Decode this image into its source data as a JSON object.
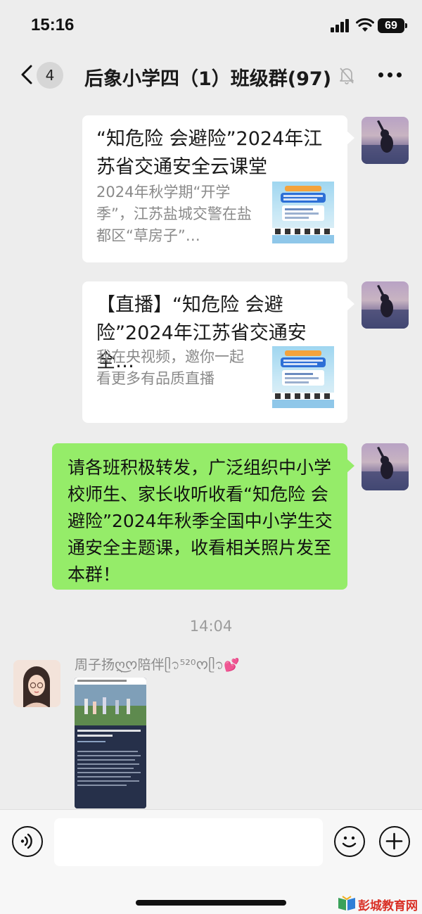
{
  "status_bar": {
    "time": "15:16",
    "battery": "69"
  },
  "header": {
    "unread_count": "4",
    "title": "后象小学四（1）班级群(97)"
  },
  "messages": [
    {
      "type": "link_card",
      "title": "“知危险 会避险”2024年江苏省交通安全云课堂",
      "description": "2024年秋学期“开学季”，江苏盐城交警在盐都区“草房子”…"
    },
    {
      "type": "link_card",
      "title": "【直播】“知危险 会避险”2024年江苏省交通安全…",
      "description": "我在央视频，邀你一起看更多有品质直播"
    },
    {
      "type": "text",
      "text": "请各班积极转发，广泛组织中小学校师生、家长收听收看“知危险 会避险”2024年秋季全国中小学生交通安全主题课，收看相关照片发至本群！"
    }
  ],
  "timestamp": "14:04",
  "incoming": {
    "sender_name": "周子扬ღ͜ᰔ陪伴ᥫ᭡⁵²⁰ᰔᥫ᭡"
  },
  "watermark": {
    "text": "彭城教育网"
  },
  "colors": {
    "chat_background": "#ededed",
    "sent_bubble": "#95ec69",
    "card_background": "#ffffff",
    "secondary_text": "#8a8a8a",
    "watermark_red": "#d93026"
  },
  "icons": {
    "back": "chevron-left-icon",
    "mute": "bell-slash-icon",
    "more": "ellipsis-icon",
    "voice": "voice-icon",
    "emoji": "smile-icon",
    "plus": "plus-icon"
  }
}
